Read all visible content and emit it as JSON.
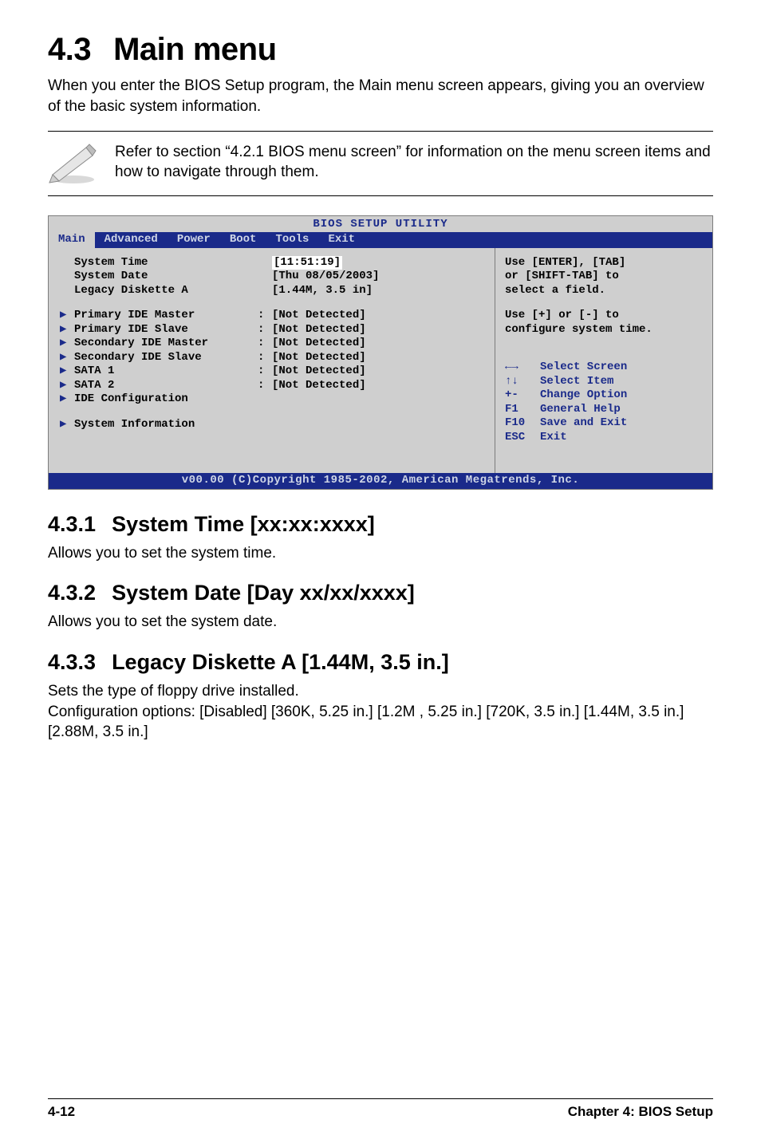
{
  "heading": {
    "number": "4.3",
    "title": "Main menu"
  },
  "intro": "When you enter the BIOS Setup program, the Main menu screen appears, giving you an overview of the basic system information.",
  "note": "Refer to section “4.2.1  BIOS menu screen” for information on the menu screen items and how to navigate through them.",
  "bios": {
    "title": "BIOS SETUP UTILITY",
    "tabs": [
      "Main",
      "Advanced",
      "Power",
      "Boot",
      "Tools",
      "Exit"
    ],
    "active_tab": "Main",
    "top_rows": [
      {
        "label": "System Time",
        "value": "[11:51:19]",
        "selected": true
      },
      {
        "label": "System Date",
        "value": "[Thu 08/05/2003]"
      },
      {
        "label": "Legacy Diskette A",
        "value": "[1.44M, 3.5 in]"
      }
    ],
    "sub_rows": [
      {
        "label": "Primary IDE Master",
        "value": "[Not Detected]"
      },
      {
        "label": "Primary IDE Slave",
        "value": "[Not Detected]"
      },
      {
        "label": "Secondary IDE Master",
        "value": "[Not Detected]"
      },
      {
        "label": "Secondary IDE Slave",
        "value": "[Not Detected]"
      },
      {
        "label": "SATA 1",
        "value": "[Not Detected]"
      },
      {
        "label": "SATA 2",
        "value": "[Not Detected]"
      },
      {
        "label": "IDE Configuration",
        "value": ""
      }
    ],
    "extra_row": {
      "label": "System Information",
      "value": ""
    },
    "help": {
      "l1": "Use [ENTER], [TAB]",
      "l2": "or [SHIFT-TAB] to",
      "l3": "select a field.",
      "l4": "Use [+] or [-] to",
      "l5": "configure system time."
    },
    "keys": [
      {
        "k": "←→",
        "d": "Select Screen"
      },
      {
        "k": "↑↓",
        "d": "Select Item"
      },
      {
        "k": "+-",
        "d": "Change Option"
      },
      {
        "k": "F1",
        "d": "General Help"
      },
      {
        "k": "F10",
        "d": "Save and Exit"
      },
      {
        "k": "ESC",
        "d": "Exit"
      }
    ],
    "footer": "v00.00 (C)Copyright 1985-2002, American Megatrends, Inc."
  },
  "subs": [
    {
      "num": "4.3.1",
      "title": "System Time [xx:xx:xxxx]",
      "body": "Allows you to set the system time."
    },
    {
      "num": "4.3.2",
      "title": "System Date [Day xx/xx/xxxx]",
      "body": "Allows you to set the system date."
    },
    {
      "num": "4.3.3",
      "title": "Legacy Diskette A [1.44M, 3.5 in.]",
      "body": "Sets the type of floppy drive installed.\nConfiguration options: [Disabled] [360K, 5.25 in.] [1.2M , 5.25 in.] [720K, 3.5 in.] [1.44M, 3.5 in.] [2.88M, 3.5 in.]"
    }
  ],
  "footer": {
    "left": "4-12",
    "right": "Chapter 4: BIOS Setup"
  }
}
